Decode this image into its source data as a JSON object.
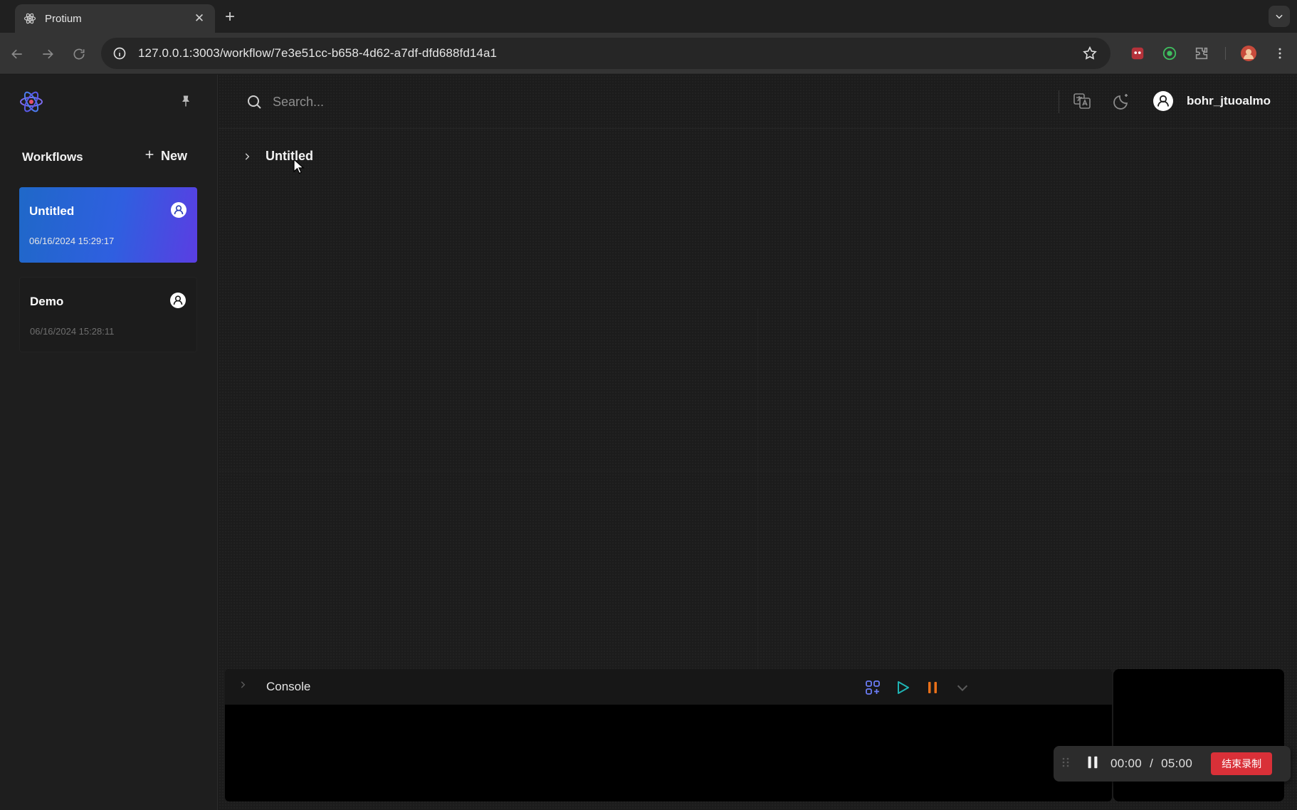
{
  "browser": {
    "tab_title": "Protium",
    "url": "127.0.0.1:3003/workflow/7e3e51cc-b658-4d62-a7df-dfd688fd14a1"
  },
  "sidebar": {
    "section_title": "Workflows",
    "new_label": "New",
    "workflows": [
      {
        "name": "Untitled",
        "date": "06/16/2024 15:29:17",
        "active": true
      },
      {
        "name": "Demo",
        "date": "06/16/2024 15:28:11",
        "active": false
      }
    ]
  },
  "topbar": {
    "search_placeholder": "Search...",
    "username": "bohr_jtuoalmo"
  },
  "tree": {
    "root_label": "Untitled"
  },
  "console": {
    "title": "Console"
  },
  "recorder": {
    "time_current": "00:00",
    "time_separator": "/",
    "time_total": "05:00",
    "stop_label": "结束录制"
  },
  "colors": {
    "accent_blue": "#2f5fe0",
    "accent_purple": "#5a3ee2",
    "play_teal": "#1fb3b3",
    "pause_orange": "#e8701a",
    "stop_red": "#d93038"
  }
}
